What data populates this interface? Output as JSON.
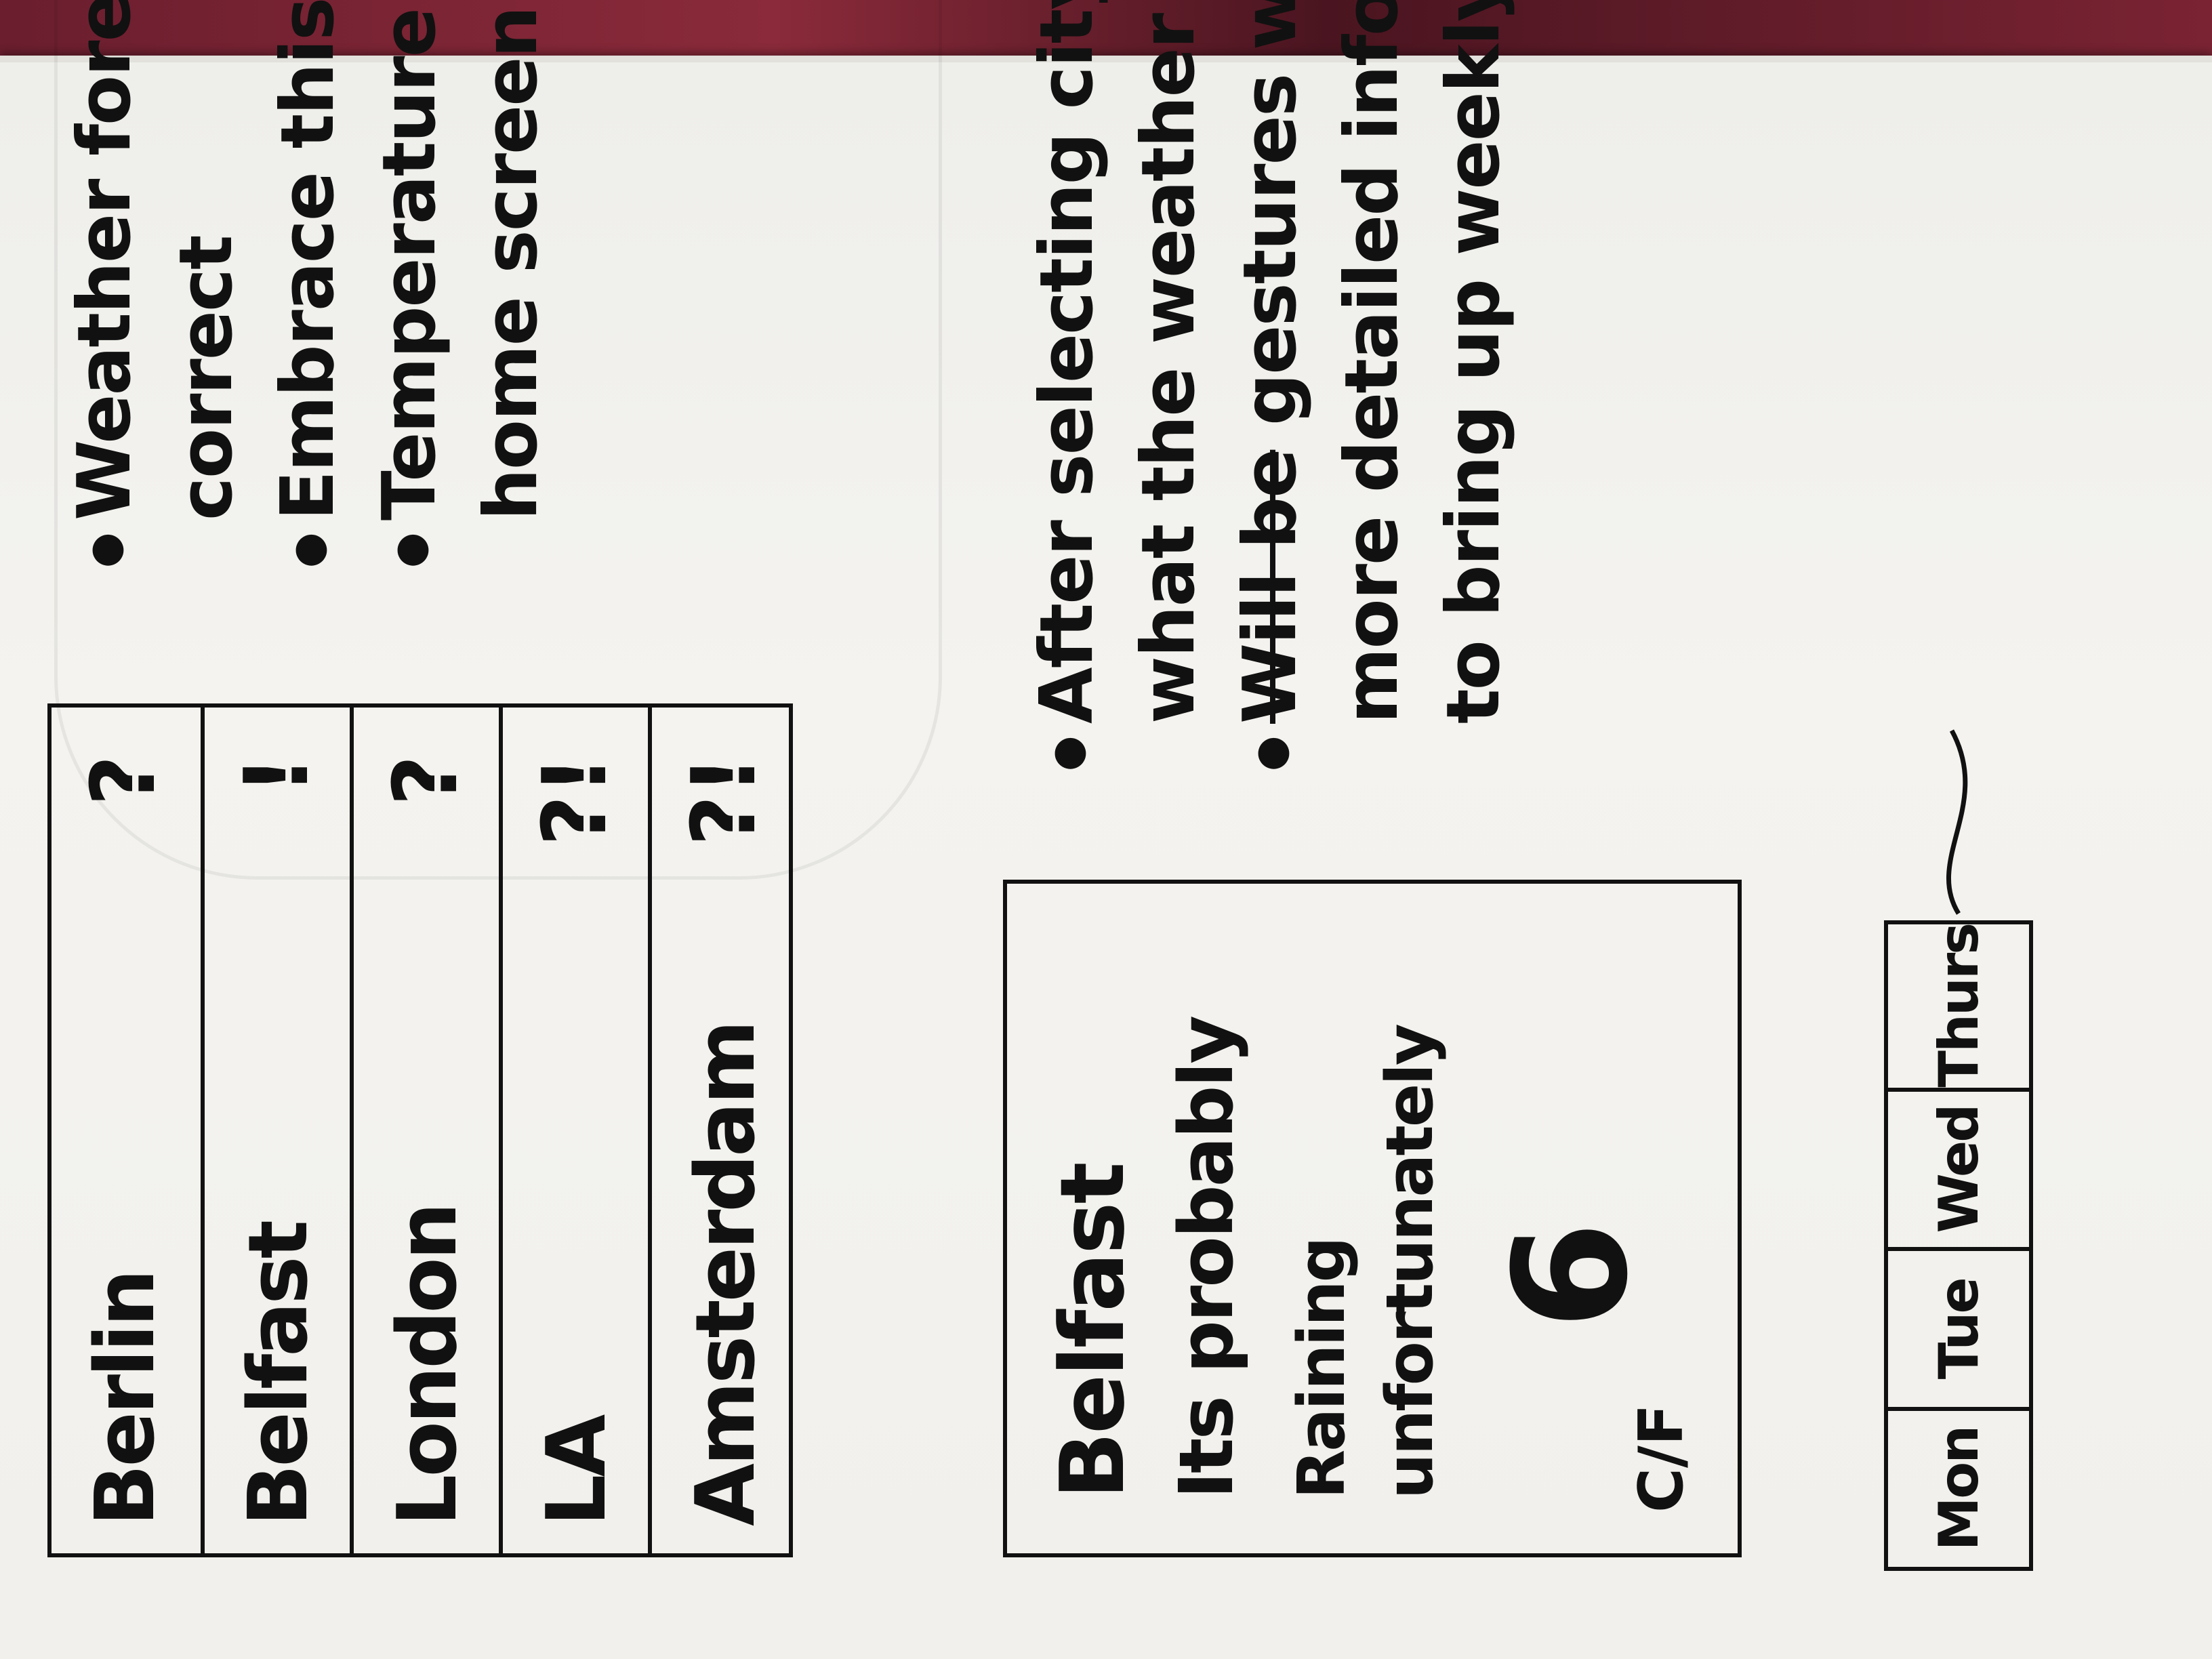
{
  "city_list": {
    "rows": [
      {
        "name": "Berlin",
        "value": "?"
      },
      {
        "name": "Belfast",
        "value": "!"
      },
      {
        "name": "London",
        "value": "?"
      },
      {
        "name": "LA",
        "value": "?!"
      },
      {
        "name": "Amsterdam",
        "value": "?!"
      }
    ]
  },
  "detail": {
    "city": "Belfast",
    "line1": "Its probably",
    "line2": "Raining",
    "line3": "unfortunately",
    "temperature": "6",
    "unit_toggle": "C/F"
  },
  "week": {
    "days": [
      "Mon",
      "Tue",
      "Wed",
      "Thurs"
    ]
  },
  "notes_top": [
    "Weather forecasting isn't always correct",
    "Embrace this fact and make joke of it",
    "Temperature won't be shown on main home screen"
  ],
  "notes_bottom": {
    "n1": "After selecting city the app will calculate what the weather is 'Probably doing.'",
    "n2_struck": "Will be",
    "n2": "gestures will be used to bring up more detailed info. ie; slide from bottom to bring up weekly forecast"
  }
}
